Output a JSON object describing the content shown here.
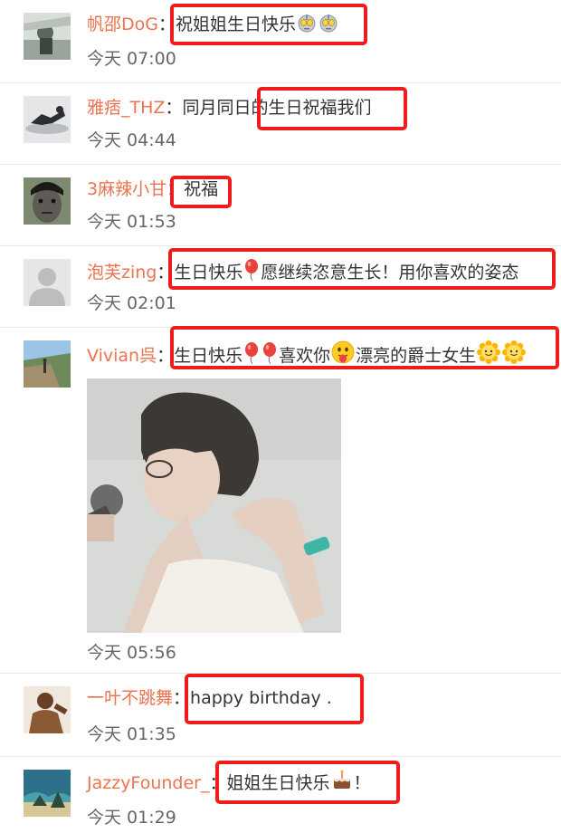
{
  "comments": [
    {
      "user": "帆邵DoG",
      "sep": "：",
      "text": "祝姐姐生日快乐",
      "time": "今天 07:00",
      "emojis": [
        "ultraman-icon",
        "ultraman-icon"
      ]
    },
    {
      "user": "雅痞_THZ",
      "sep": "：",
      "text": "同月同日的生日祝福我们",
      "time": "今天 04:44",
      "emojis": []
    },
    {
      "user": "3麻辣小甘",
      "sep": "：",
      "text": "祝福",
      "time": "今天 01:53",
      "emojis": []
    },
    {
      "user": "泡芙zing",
      "sep": "：",
      "text_a": "生日快乐",
      "text_b": "愿继续恣意生长！用你喜欢的姿态",
      "time": "今天 02:01",
      "emojis": [
        "balloon-icon"
      ]
    },
    {
      "user": "Vivian呉",
      "sep": "：",
      "text_a": "生日快乐",
      "text_b": "喜欢你",
      "text_c": "漂亮的爵士女生",
      "time": "今天 05:56",
      "emojis": [
        "balloon-icon",
        "balloon-icon",
        "tongue-face-icon",
        "sunflower-icon",
        "sunflower-icon"
      ]
    },
    {
      "user": "一叶不跳舞",
      "sep": "：",
      "text": "happy  birthday  .",
      "time": "今天 01:35",
      "emojis": []
    },
    {
      "user": "JazzyFounder_",
      "sep": "：",
      "text": "姐姐生日快乐",
      "text_end": "！",
      "time": "今天 01:29",
      "emojis": [
        "cake-icon"
      ]
    }
  ],
  "colors": {
    "username": "#eb7350",
    "highlight": "#ee1c1c",
    "text": "#333333",
    "time": "#666666"
  }
}
